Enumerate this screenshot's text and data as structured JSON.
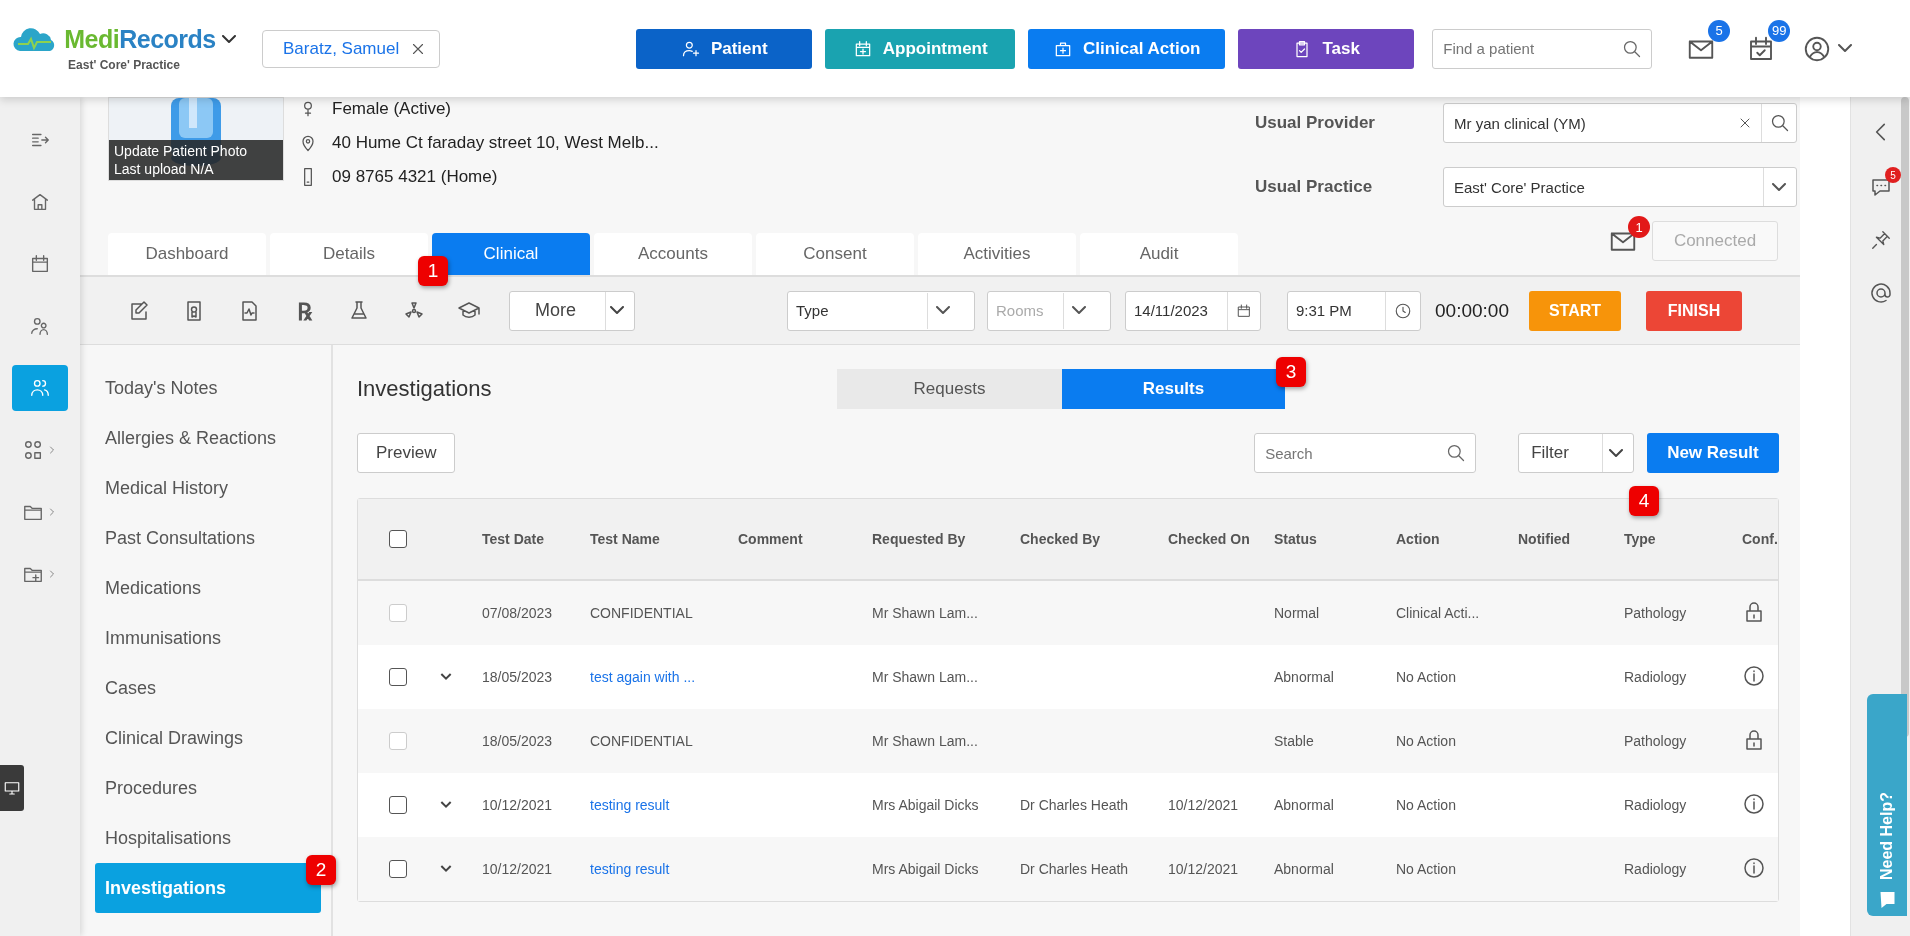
{
  "header": {
    "logo_parts": [
      "Medi",
      "Records"
    ],
    "practice": "East' Core' Practice",
    "patient_chip": "Baratz, Samuel",
    "actions": [
      {
        "label": "Patient",
        "kind": "patient"
      },
      {
        "label": "Appointment",
        "kind": "appointment"
      },
      {
        "label": "Clinical Action",
        "kind": "clinical"
      },
      {
        "label": "Task",
        "kind": "task"
      }
    ],
    "search": {
      "placeholder": "Find a patient"
    },
    "mail_badge": "5",
    "calendar_badge": "99"
  },
  "nav_rail": [
    {
      "kind": "collapse",
      "selected": false,
      "submenu": false
    },
    {
      "kind": "home",
      "selected": false,
      "submenu": false
    },
    {
      "kind": "calendar",
      "selected": false,
      "submenu": false
    },
    {
      "kind": "billing",
      "selected": false,
      "submenu": false
    },
    {
      "kind": "patients",
      "selected": true,
      "submenu": false
    },
    {
      "kind": "apps",
      "selected": false,
      "submenu": true
    },
    {
      "kind": "folder",
      "selected": false,
      "submenu": true
    },
    {
      "kind": "folder-add",
      "selected": false,
      "submenu": true
    }
  ],
  "patient": {
    "photo_caption": [
      "Update Patient Photo",
      "Last upload N/A"
    ],
    "sex": "Female (Active)",
    "address": "40 Hume Ct faraday street 10, West Melb...",
    "phone": "09 8765 4321 (Home)",
    "usual_provider": {
      "label": "Usual Provider",
      "value": "Mr yan clinical (YM)"
    },
    "usual_practice": {
      "label": "Usual Practice",
      "value": "East' Core' Practice"
    },
    "message_badge": "1",
    "connection": {
      "label": "Connected",
      "disabled": true
    }
  },
  "tabs": [
    {
      "label": "Dashboard",
      "selected": false
    },
    {
      "label": "Details",
      "selected": false
    },
    {
      "label": "Clinical",
      "selected": true
    },
    {
      "label": "Accounts",
      "selected": false
    },
    {
      "label": "Consent",
      "selected": false
    },
    {
      "label": "Activities",
      "selected": false
    },
    {
      "label": "Audit",
      "selected": false
    }
  ],
  "toolbar": {
    "tools": [
      {
        "kind": "note"
      },
      {
        "kind": "certificate"
      },
      {
        "kind": "chart"
      },
      {
        "kind": "rx",
        "glyph": "℞"
      },
      {
        "kind": "lab"
      },
      {
        "kind": "radiation"
      },
      {
        "kind": "education"
      }
    ],
    "more": "More",
    "type": {
      "value": "Type"
    },
    "rooms": {
      "placeholder": "Rooms"
    },
    "date": "14/11/2023",
    "time": "9:31 PM",
    "timer": "00:00:00",
    "start": "START",
    "finish": "FINISH"
  },
  "sections": [
    {
      "label": "Today's Notes",
      "selected": false
    },
    {
      "label": "Allergies & Reactions",
      "selected": false
    },
    {
      "label": "Medical History",
      "selected": false
    },
    {
      "label": "Past Consultations",
      "selected": false
    },
    {
      "label": "Medications",
      "selected": false
    },
    {
      "label": "Immunisations",
      "selected": false
    },
    {
      "label": "Cases",
      "selected": false
    },
    {
      "label": "Clinical Drawings",
      "selected": false
    },
    {
      "label": "Procedures",
      "selected": false
    },
    {
      "label": "Hospitalisations",
      "selected": false
    },
    {
      "label": "Investigations",
      "selected": true
    }
  ],
  "investigations": {
    "title": "Investigations",
    "views": [
      {
        "label": "Requests",
        "selected": false
      },
      {
        "label": "Results",
        "selected": true
      }
    ],
    "preview": "Preview",
    "search": {
      "placeholder": "Search"
    },
    "filter": "Filter",
    "new_button": "New Result",
    "table": {
      "all_checked": false,
      "columns": [
        "Test Date",
        "Test Name",
        "Comment",
        "Requested By",
        "Checked By",
        "Checked On",
        "Status",
        "Action",
        "Notified",
        "Type",
        "Conf."
      ],
      "rows": [
        {
          "kind": "confidential",
          "checked": false,
          "disabled": true,
          "expandable": false,
          "test_date": "07/08/2023",
          "test_name": "CONFIDENTIAL",
          "requested_by": "Mr Shawn Lam...",
          "status": "Normal",
          "action": "Clinical Acti...",
          "type": "Pathology"
        },
        {
          "kind": "result",
          "checked": false,
          "disabled": false,
          "expandable": true,
          "test_date": "18/05/2023",
          "test_name": "test again with ...",
          "requested_by": "Mr Shawn Lam...",
          "status": "Abnormal",
          "action": "No Action",
          "type": "Radiology"
        },
        {
          "kind": "confidential",
          "checked": false,
          "disabled": true,
          "expandable": false,
          "test_date": "18/05/2023",
          "test_name": "CONFIDENTIAL",
          "requested_by": "Mr Shawn Lam...",
          "status": "Stable",
          "action": "No Action",
          "type": "Pathology"
        },
        {
          "kind": "result",
          "checked": false,
          "disabled": false,
          "expandable": true,
          "test_date": "10/12/2021",
          "test_name": "testing result",
          "requested_by": "Mrs Abigail Dicks",
          "checked_by": "Dr Charles Heath",
          "checked_on": "10/12/2021",
          "status": "Abnormal",
          "action": "No Action",
          "type": "Radiology"
        },
        {
          "kind": "result",
          "checked": false,
          "disabled": false,
          "expandable": true,
          "test_date": "10/12/2021",
          "test_name": "testing result",
          "requested_by": "Mrs Abigail Dicks",
          "checked_by": "Dr Charles Heath",
          "checked_on": "10/12/2021",
          "status": "Abnormal",
          "action": "No Action",
          "type": "Radiology"
        }
      ]
    }
  },
  "right_rail": {
    "chat_badge": "5"
  },
  "help_tab": "Need Help?",
  "annotations": [
    {
      "number": "1"
    },
    {
      "number": "2"
    },
    {
      "number": "3"
    },
    {
      "number": "4"
    }
  ]
}
